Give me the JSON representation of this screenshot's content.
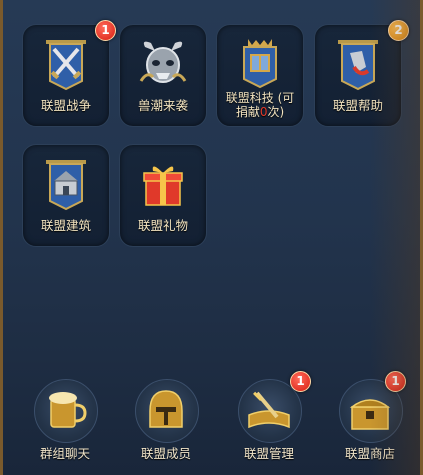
{
  "tiles": [
    {
      "label": "联盟战争",
      "icon": "crossed-swords-banner-icon",
      "badge": "1",
      "badge_color": "red"
    },
    {
      "label": "兽潮来袭",
      "icon": "beast-skull-icon",
      "badge": "",
      "badge_color": ""
    },
    {
      "label_line1": "联盟科技 (可",
      "label_line2_pre": "捐献",
      "label_line2_num": "0",
      "label_line2_post": "次)",
      "icon": "tech-banner-icon"
    },
    {
      "label": "联盟帮助",
      "icon": "help-banner-icon",
      "badge": "2",
      "badge_color": "orange"
    },
    {
      "label": "联盟建筑",
      "icon": "building-banner-icon"
    },
    {
      "label": "联盟礼物",
      "icon": "gift-box-icon"
    }
  ],
  "bottom": [
    {
      "label": "群组聊天",
      "icon": "beer-mug-icon",
      "badge": ""
    },
    {
      "label": "联盟成员",
      "icon": "helmet-icon",
      "badge": ""
    },
    {
      "label": "联盟管理",
      "icon": "book-sword-icon",
      "badge": "1"
    },
    {
      "label": "联盟商店",
      "icon": "treasure-chest-icon",
      "badge": "1"
    }
  ],
  "colors": {
    "badge_red": "#d81e12",
    "badge_orange": "#e08a12",
    "label": "#f2e3bf",
    "gold": "#d4a84a",
    "donate_zero": "#e03a2a"
  }
}
